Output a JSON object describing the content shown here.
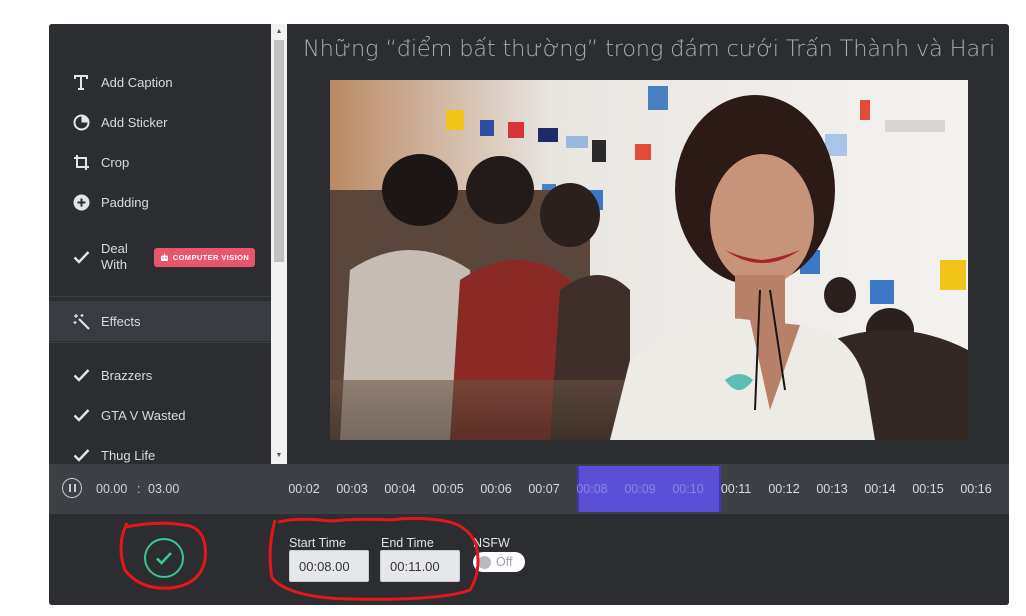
{
  "sidebar": {
    "items": [
      {
        "label": "Add Caption",
        "icon": "text-icon"
      },
      {
        "label": "Add Sticker",
        "icon": "sticker-icon"
      },
      {
        "label": "Crop",
        "icon": "crop-icon"
      },
      {
        "label": "Padding",
        "icon": "plus-circle-icon"
      },
      {
        "label_line1": "Deal",
        "label_line2": "With",
        "icon": "check-icon",
        "badge": "COMPUTER VISION"
      },
      {
        "label": "Effects",
        "icon": "magic-wand-icon",
        "active": true
      },
      {
        "label": "Brazzers",
        "icon": "check-icon"
      },
      {
        "label": "GTA V Wasted",
        "icon": "check-icon"
      },
      {
        "label": "Thug Life",
        "icon": "check-icon"
      }
    ]
  },
  "video": {
    "title": "Những “điểm bất thường” trong đám cưới Trấn Thành và Hari"
  },
  "player": {
    "current": "00.00",
    "separator": ":",
    "total": "03.00"
  },
  "timeline": {
    "ticks": [
      "00:02",
      "00:03",
      "00:04",
      "00:05",
      "00:06",
      "00:07",
      "00:08",
      "00:09",
      "00:10",
      "00:11",
      "00:12",
      "00:13",
      "00:14",
      "00:15",
      "00:16"
    ],
    "selection_start": "00:08",
    "selection_end": "00:11"
  },
  "form": {
    "start_label": "Start Time",
    "start_value": "00:08.00",
    "end_label": "End Time",
    "end_value": "00:11.00",
    "nsfw_label": "NSFW",
    "nsfw_state": "Off"
  },
  "colors": {
    "panel": "#2b2d31",
    "timeline": "#3d4045",
    "selection": "#5b4fd6",
    "accent_green": "#37c98d",
    "badge_pink": "#e9566b",
    "annotation_red": "#e8141c"
  }
}
